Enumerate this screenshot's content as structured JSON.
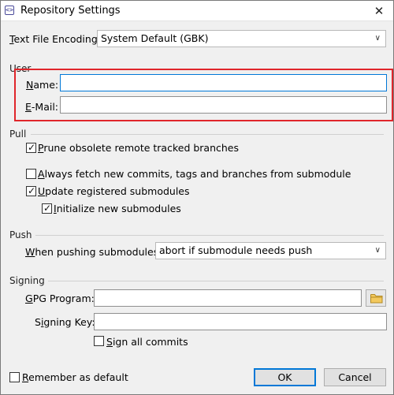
{
  "window": {
    "title": "Repository Settings",
    "close_glyph": "✕",
    "icon_glyph": "<>"
  },
  "encoding": {
    "label_first": "T",
    "label_rest": "ext File Encoding:",
    "value": "System Default (GBK)"
  },
  "user": {
    "group_label": "User",
    "name_label_first": "N",
    "name_label_rest": "ame:",
    "name_value": "",
    "email_label_first": "E",
    "email_label_rest": "-Mail:",
    "email_value": ""
  },
  "pull": {
    "group_label": "Pull",
    "prune": {
      "first": "P",
      "rest": "rune obsolete remote tracked branches",
      "checked": true
    },
    "fetch": {
      "first": "A",
      "rest": "lways fetch new commits, tags and branches from submodule",
      "checked": false
    },
    "update": {
      "first": "U",
      "rest": "pdate registered submodules",
      "checked": true
    },
    "init": {
      "first": "I",
      "rest": "nitialize new submodules",
      "checked": true
    }
  },
  "push": {
    "group_label": "Push",
    "label_first": "W",
    "label_rest": "hen pushing submodules:",
    "value": "abort if submodule needs push"
  },
  "signing": {
    "group_label": "Signing",
    "gpg_label_first": "G",
    "gpg_label_rest": "PG Program:",
    "gpg_value": "",
    "key_label_pre": "S",
    "key_label_first": "i",
    "key_label_rest": "gning Key:",
    "key_value": "",
    "sign_all": {
      "first": "S",
      "rest": "ign all commits",
      "checked": false
    }
  },
  "footer": {
    "remember": {
      "first": "R",
      "rest": "emember as default",
      "checked": false
    },
    "ok_label": "OK",
    "cancel_label": "Cancel"
  },
  "colors": {
    "accent": "#0078d7",
    "highlight": "#e0262b",
    "folder": "#e8b84a"
  },
  "icons": {
    "chevron": "chevron-down-icon",
    "folder": "folder-icon",
    "check": "checkmark-icon"
  }
}
